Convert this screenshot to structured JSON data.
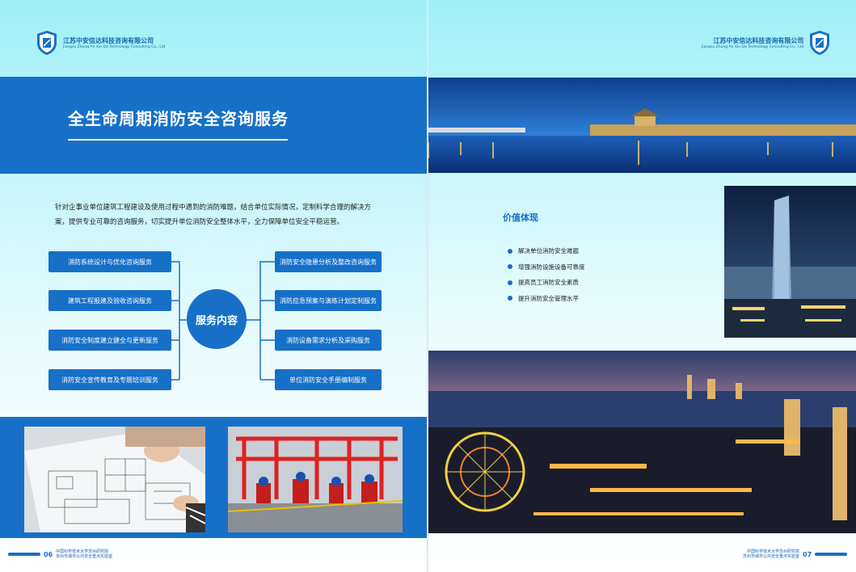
{
  "left_page": {
    "company": {
      "name_cn": "江苏中安信达科技咨询有限公司",
      "name_en": "Jiangsu Zhong An Xin Da Technology Consulting Co., Ltd"
    },
    "title": "全生命周期消防安全咨询服务",
    "intro_line1": "针对企事业单位建筑工程建设及使用过程中遇到的消防难题，结合单位实际情况，定制科学合理的解决方",
    "intro_line2": "案，提供专业可靠的咨询服务，切实提升单位消防安全整体水平，全力保障单位安全平稳运营。",
    "hub_label": "服务内容",
    "services_left": [
      {
        "label": "消防系统设计与优化咨询服务"
      },
      {
        "label": "建筑工程报建及验收咨询服务"
      },
      {
        "label": "消防安全制度建立健全与更新服务"
      },
      {
        "label": "消防安全宣传教育及专题培训服务"
      }
    ],
    "services_right": [
      {
        "label": "消防安全隐患分析及整改咨询服务"
      },
      {
        "label": "消防应急预案与演练计划定制服务"
      },
      {
        "label": "消防设备需求分析及采购服务"
      },
      {
        "label": "单位消防安全手册编制服务"
      }
    ],
    "footer": {
      "page_number": "06",
      "line1": "中国科学技术大学苏州研究院",
      "line2": "苏州市城市公共安全重点实验室"
    }
  },
  "right_page": {
    "company": {
      "name_cn": "江苏中安信达科技咨询有限公司",
      "name_en": "Jiangsu Zhong An Xin Da Technology Consulting Co., Ltd"
    },
    "value_heading": "价值体现",
    "values": [
      {
        "label": "解决单位消防安全难题"
      },
      {
        "label": "增强消防设施设备可靠度"
      },
      {
        "label": "提高员工消防安全素质"
      },
      {
        "label": "提升消防安全管理水平"
      }
    ],
    "footer": {
      "page_number": "07",
      "line1": "中国科学技术大学苏州研究院",
      "line2": "苏州市城市公共安全重点实验室"
    }
  },
  "colors": {
    "brand_blue": "#1670c8",
    "sky_cyan": "#9ff0f6"
  }
}
